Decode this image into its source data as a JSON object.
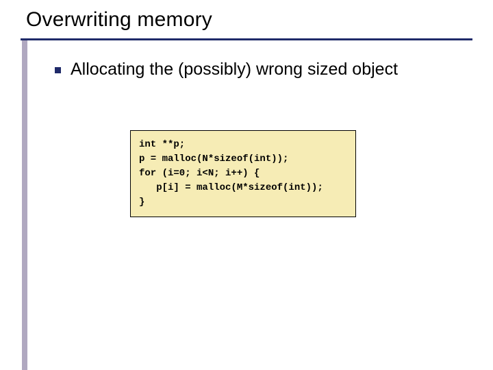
{
  "title": "Overwriting memory",
  "bullet": "Allocating the (possibly) wrong sized object",
  "code": {
    "line1": "int **p;",
    "blank1": "",
    "line2": "p = malloc(N*sizeof(int));",
    "blank2": "",
    "line3": "for (i=0; i<N; i++) {",
    "line4": "   p[i] = malloc(M*sizeof(int));",
    "line5": "}"
  }
}
